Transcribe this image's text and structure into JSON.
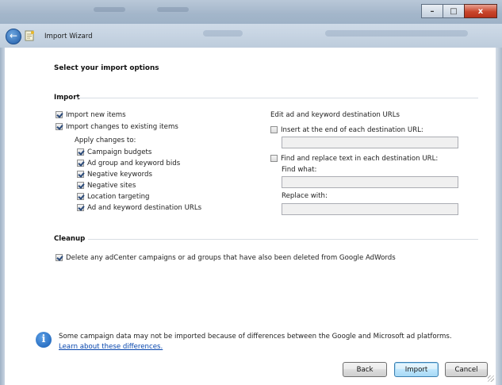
{
  "window": {
    "title": "Import Wizard",
    "controls": {
      "minimize": "–",
      "maximize": "□",
      "close": "x"
    }
  },
  "page": {
    "heading": "Select your import options"
  },
  "import_section": {
    "title": "Import",
    "import_new_items": {
      "label": "Import new items",
      "checked": true
    },
    "import_changes": {
      "label": "Import changes to existing items",
      "checked": true
    },
    "apply_changes_label": "Apply changes to:",
    "apply_items": [
      {
        "label": "Campaign budgets",
        "checked": true
      },
      {
        "label": "Ad group and keyword bids",
        "checked": true
      },
      {
        "label": "Negative keywords",
        "checked": true
      },
      {
        "label": "Negative sites",
        "checked": true
      },
      {
        "label": "Location targeting",
        "checked": true
      },
      {
        "label": "Ad and keyword destination URLs",
        "checked": true
      }
    ],
    "edit_urls": {
      "title": "Edit ad and keyword destination URLs",
      "insert_end": {
        "label": "Insert at the end of each destination URL:",
        "checked": false,
        "value": ""
      },
      "find_replace": {
        "label": "Find and replace text in each destination URL:",
        "checked": false
      },
      "find_what": {
        "label": "Find what:",
        "value": ""
      },
      "replace_with": {
        "label": "Replace with:",
        "value": ""
      }
    }
  },
  "cleanup_section": {
    "title": "Cleanup",
    "delete_option": {
      "label": "Delete any adCenter campaigns or ad groups that have also been deleted from Google AdWords",
      "checked": true
    }
  },
  "footer": {
    "info_text": "Some campaign data may not be imported because of differences between the Google and Microsoft ad platforms.",
    "info_link": "Learn about these differences.",
    "buttons": {
      "back": "Back",
      "import": "Import",
      "cancel": "Cancel"
    }
  }
}
